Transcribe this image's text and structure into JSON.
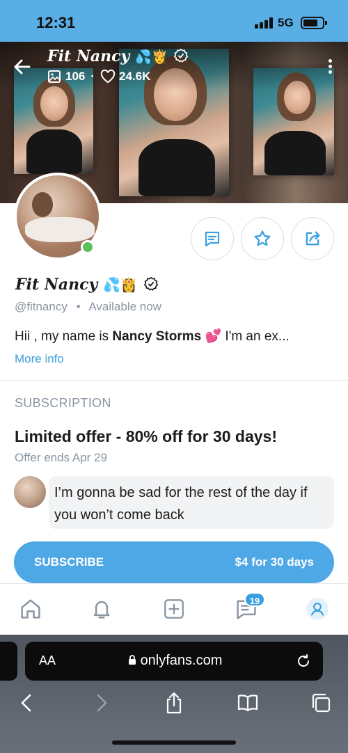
{
  "status_bar": {
    "time": "12:31",
    "network": "5G"
  },
  "profile": {
    "display_name": "Fit Nancy",
    "name_emoji": "💦👸",
    "posts_count": "106",
    "likes_count": "24.6K",
    "handle": "@fitnancy",
    "availability": "Available now",
    "bio_prefix": "Hii , my name is ",
    "bio_bold": "Nancy Storms",
    "bio_suffix": " 💕 I'm an ex...",
    "more_info": "More info"
  },
  "subscription": {
    "heading": "SUBSCRIPTION",
    "offer_title": "Limited offer - 80% off for 30 days!",
    "offer_ends": "Offer ends Apr 29",
    "message": "I’m gonna be sad for the rest of the day if you won’t come back",
    "button_label": "SUBSCRIBE",
    "button_price": "$4 for 30 days"
  },
  "bottom_nav": {
    "messages_badge": "19"
  },
  "browser": {
    "aa": "AA",
    "url": "onlyfans.com"
  },
  "colors": {
    "accent": "#4fa8e6",
    "status_bar": "#5aaee6",
    "online": "#5bc15b",
    "muted": "#8a96a3"
  },
  "icons": [
    "back-arrow-icon",
    "image-icon",
    "heart-icon",
    "verified-icon",
    "more-vertical-icon",
    "message-icon",
    "star-icon",
    "share-icon",
    "home-icon",
    "bell-icon",
    "plus-square-icon",
    "chat-icon",
    "profile-icon",
    "lock-icon",
    "reload-icon",
    "chevron-left-icon",
    "chevron-right-icon",
    "share-upload-icon",
    "book-icon",
    "tabs-icon"
  ]
}
